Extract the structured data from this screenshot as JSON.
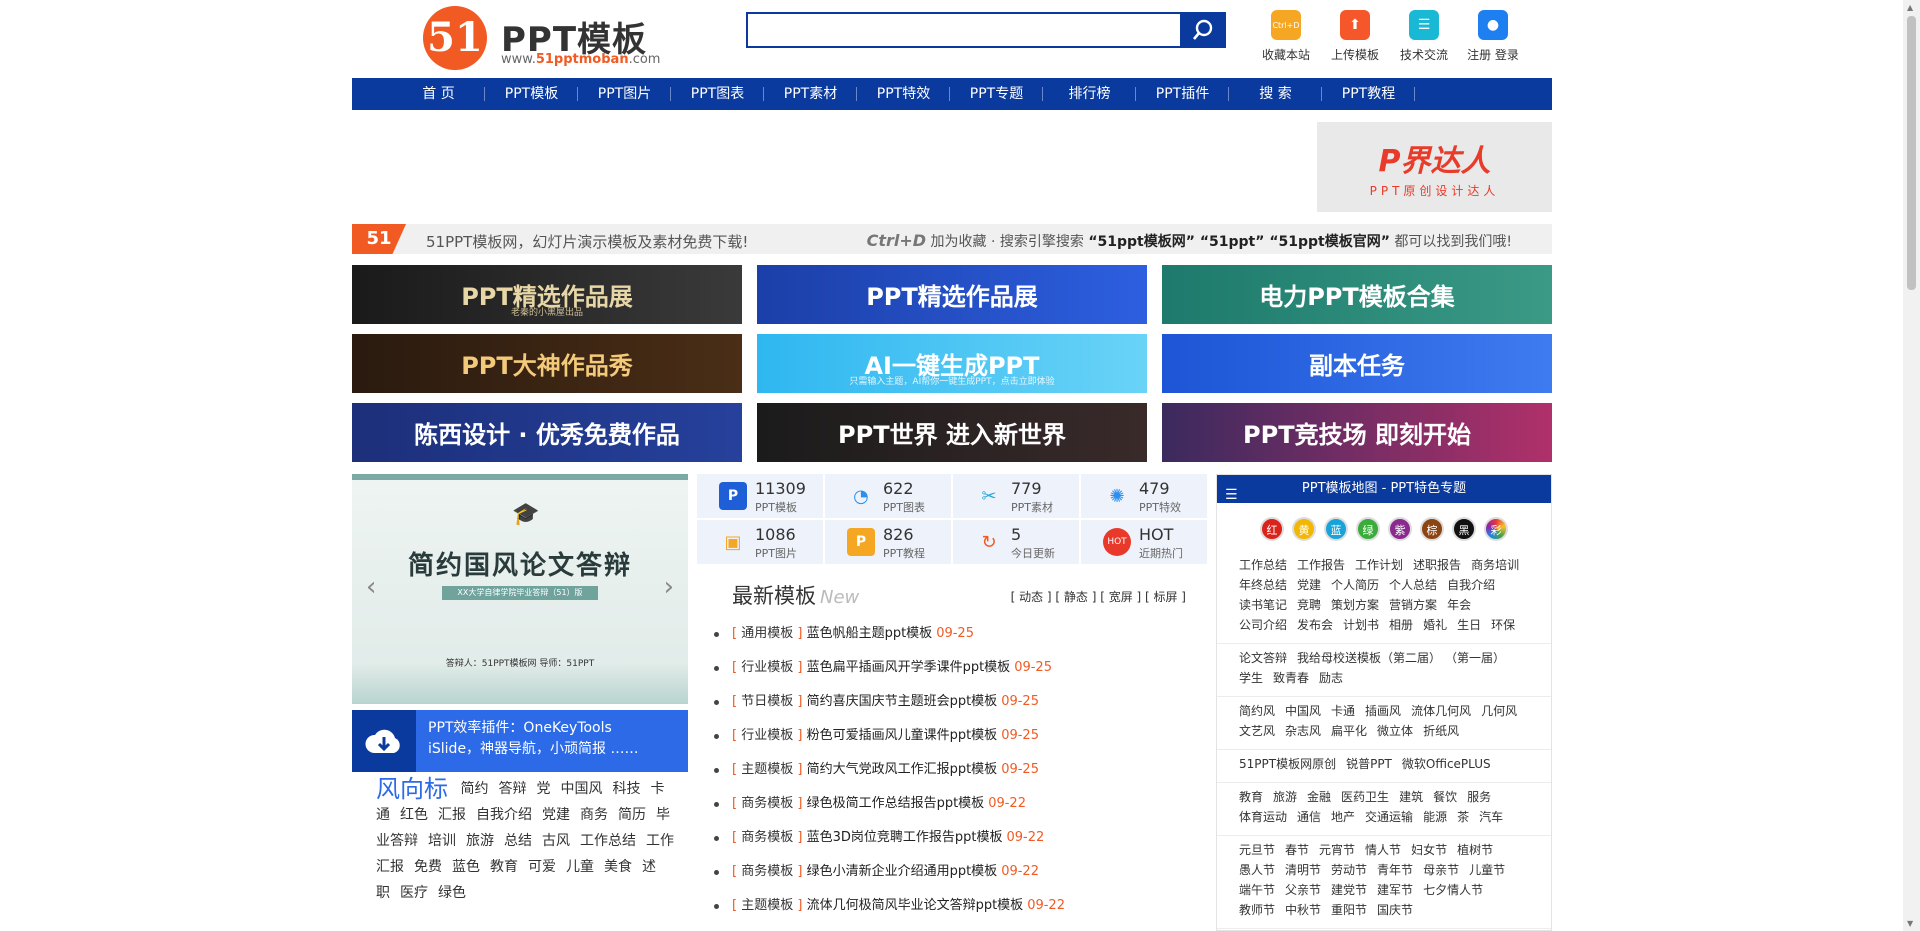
{
  "logo": {
    "mark": "51",
    "title": "PPT模板",
    "url_prefix": "www.",
    "url_brand": "51pptmoban",
    "url_suffix": ".com"
  },
  "search": {
    "placeholder": ""
  },
  "toplinks": [
    {
      "label": "收藏本站",
      "icon": "bookmark-icon",
      "glyph": "Ctrl+D",
      "color": "#f5a623"
    },
    {
      "label": "上传模板",
      "icon": "upload-icon",
      "glyph": "⬆",
      "color": "#f5572a"
    },
    {
      "label": "技术交流",
      "icon": "chat-icon",
      "glyph": "☰",
      "color": "#19b9d6"
    },
    {
      "label": "注册 登录",
      "icon": "user-icon",
      "glyph": "●",
      "color": "#1e7ff0"
    }
  ],
  "nav": [
    "首 页",
    "PPT模板",
    "PPT图片",
    "PPT图表",
    "PPT素材",
    "PPT特效",
    "PPT专题",
    "排行榜",
    "PPT插件",
    "搜 索",
    "PPT教程"
  ],
  "ad": {
    "title": "P界达人",
    "sub": "PPT原创设计达人"
  },
  "notice": {
    "logo": "51",
    "left": "51PPT模板网，幻灯片演示模板及素材免费下载!",
    "ctrl": "Ctrl+D",
    "right_a": " 加为收藏 · 搜索引擎搜索 ",
    "right_b": "“51ppt模板网” “51ppt” “51ppt模板官网”",
    "right_c": " 都可以找到我们哦!"
  },
  "banners": [
    {
      "title": "PPT精选作品展",
      "sub": "老秦的小黑屋出品",
      "bg": "linear-gradient(90deg,#1a1a1a,#3a3a3a)",
      "color": "#e8d7a6"
    },
    {
      "title": "PPT精选作品展",
      "sub": "",
      "bg": "linear-gradient(90deg,#1c3fa8,#2d5fe0)",
      "color": "#ffffff"
    },
    {
      "title": "电力PPT模板合集",
      "sub": "",
      "bg": "linear-gradient(90deg,#1d7a6c,#3b9a86)",
      "color": "#ffffff"
    },
    {
      "title": "PPT大神作品秀",
      "sub": "",
      "bg": "linear-gradient(90deg,#2a1a0f,#4a2e16)",
      "color": "#f3c97a"
    },
    {
      "title": "AI一键生成PPT",
      "sub": "只需输入主题，AI帮你一键生成PPT，点击立即体验",
      "bg": "linear-gradient(90deg,#2fb7f0,#69d3f7)",
      "color": "#ffffff"
    },
    {
      "title": "副本任务",
      "sub": "",
      "bg": "linear-gradient(90deg,#1d55d6,#3f7bf0)",
      "color": "#ffffff"
    },
    {
      "title": "陈西设计 · 优秀免费作品",
      "sub": "",
      "bg": "linear-gradient(90deg,#1c2f7a,#26419c)",
      "color": "#ffffff"
    },
    {
      "title": "PPT世界  进入新世界",
      "sub": "",
      "bg": "linear-gradient(90deg,#1b1b1b,#3a2a2a)",
      "color": "#ffffff"
    },
    {
      "title": "PPT竞技场  即刻开始",
      "sub": "",
      "bg": "linear-gradient(90deg,#3b2a5e,#b0306a)",
      "color": "#ffffff"
    }
  ],
  "slider": {
    "title": "简约国风论文答辩",
    "sub": "XX大学自律学院毕业答辩（51）版",
    "meta": "答辩人：51PPT模板网     导师：51PPT"
  },
  "plugin": {
    "line1": "PPT效率插件：OneKeyTools",
    "line2": "iSlide，神器导航，小顽简报 ……"
  },
  "tags": {
    "title": "风向标",
    "items": [
      "简约",
      "答辩",
      "党",
      "中国风",
      "科技",
      "卡通",
      "红色",
      "汇报",
      "自我介绍",
      "党建",
      "商务",
      "简历",
      "毕业答辩",
      "培训",
      "旅游",
      "总结",
      "古风",
      "工作总结",
      "工作汇报",
      "免费",
      "蓝色",
      "教育",
      "可爱",
      "儿童",
      "美食",
      "述职",
      "医疗",
      "绿色"
    ]
  },
  "stats": [
    {
      "num": "11309",
      "label": "PPT模板",
      "glyph": "P",
      "color": "#1e5fd8"
    },
    {
      "num": "622",
      "label": "PPT图表",
      "glyph": "◔",
      "color": "#2c8ff0"
    },
    {
      "num": "779",
      "label": "PPT素材",
      "glyph": "✂",
      "color": "#2aa7e0"
    },
    {
      "num": "479",
      "label": "PPT特效",
      "glyph": "✺",
      "color": "#2c8ff0"
    },
    {
      "num": "1086",
      "label": "PPT图片",
      "glyph": "▣",
      "color": "#f5a623"
    },
    {
      "num": "826",
      "label": "PPT教程",
      "glyph": "P",
      "color": "#f5a623"
    },
    {
      "num": "5",
      "label": "今日更新",
      "glyph": "↻",
      "color": "#f15a22"
    },
    {
      "num": "HOT",
      "label": "近期热门",
      "glyph": "HOT",
      "color": "#e8392a"
    }
  ],
  "latest": {
    "title": "最新模板",
    "new": "New",
    "filters": "[ 动态 ] [ 静态 ] [ 宽屏 ] [ 标屏 ]"
  },
  "list": [
    {
      "cat": "通用模板",
      "title": "蓝色帆船主题ppt模板",
      "date": "09-25"
    },
    {
      "cat": "行业模板",
      "title": "蓝色扁平插画风开学季课件ppt模板",
      "date": "09-25"
    },
    {
      "cat": "节日模板",
      "title": "简约喜庆国庆节主题班会ppt模板",
      "date": "09-25"
    },
    {
      "cat": "行业模板",
      "title": "粉色可爱插画风儿童课件ppt模板",
      "date": "09-25"
    },
    {
      "cat": "主题模板",
      "title": "简约大气党政风工作汇报ppt模板",
      "date": "09-25"
    },
    {
      "cat": "商务模板",
      "title": "绿色极简工作总结报告ppt模板",
      "date": "09-22"
    },
    {
      "cat": "商务模板",
      "title": "蓝色3D岗位竞聘工作报告ppt模板",
      "date": "09-22"
    },
    {
      "cat": "商务模板",
      "title": "绿色小清新企业介绍通用ppt模板",
      "date": "09-22"
    },
    {
      "cat": "主题模板",
      "title": "流体几何极简风毕业论文答辩ppt模板",
      "date": "09-22"
    }
  ],
  "side": {
    "title": "PPT模板地图 - PPT特色专题",
    "colors": [
      {
        "label": "红",
        "hex": "#d9231c"
      },
      {
        "label": "黄",
        "hex": "#f2b705"
      },
      {
        "label": "蓝",
        "hex": "#1aa3d9"
      },
      {
        "label": "绿",
        "hex": "#3bab3b"
      },
      {
        "label": "紫",
        "hex": "#8a2a8f"
      },
      {
        "label": "棕",
        "hex": "#8b4513"
      },
      {
        "label": "黑",
        "hex": "#111111"
      },
      {
        "label": "彩",
        "hex": "#7ac943"
      }
    ],
    "sections": [
      [
        "工作总结",
        "工作报告",
        "工作计划",
        "述职报告",
        "商务培训",
        "年终总结",
        "党建",
        "个人简历",
        "个人总结",
        "自我介绍",
        "读书笔记",
        "竞聘",
        "策划方案",
        "营销方案",
        "年会",
        "公司介绍",
        "发布会",
        "计划书",
        "相册",
        "婚礼",
        "生日",
        "环保"
      ],
      [
        "论文答辩",
        "我给母校送模板（第二届）",
        "（第一届）",
        "学生",
        "致青春",
        "励志"
      ],
      [
        "简约风",
        "中国风",
        "卡通",
        "插画风",
        "流体几何风",
        "几何风",
        "文艺风",
        "杂志风",
        "扁平化",
        "微立体",
        "折纸风"
      ],
      [
        "51PPT模板网原创",
        "锐普PPT",
        "微软OfficePLUS"
      ],
      [
        "教育",
        "旅游",
        "金融",
        "医药卫生",
        "建筑",
        "餐饮",
        "服务",
        "体育运动",
        "通信",
        "地产",
        "交通运输",
        "能源",
        "茶",
        "汽车"
      ],
      [
        "元旦节",
        "春节",
        "元宵节",
        "情人节",
        "妇女节",
        "植树节",
        "愚人节",
        "清明节",
        "劳动节",
        "青年节",
        "母亲节",
        "儿童节",
        "端午节",
        "父亲节",
        "建党节",
        "建军节",
        "七夕情人节",
        "教师节",
        "中秋节",
        "重阳节",
        "国庆节"
      ]
    ]
  }
}
